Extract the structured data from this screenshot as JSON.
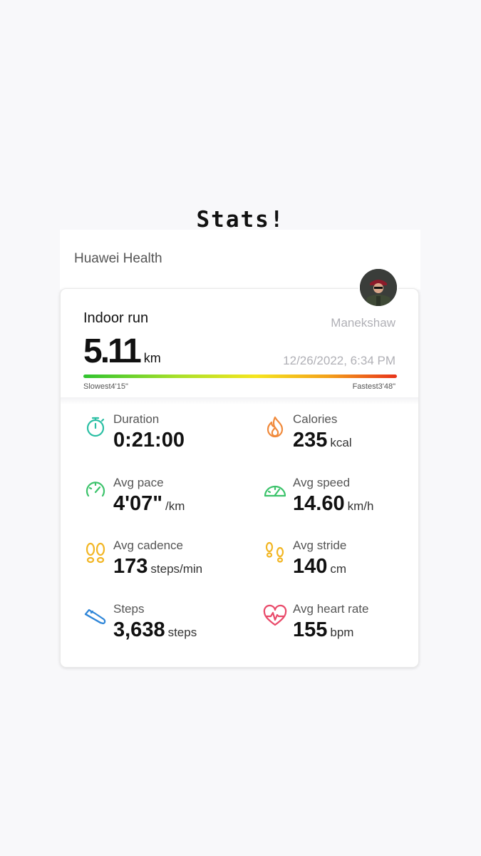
{
  "story_title": "Stats!",
  "app": {
    "name": "Huawei Health"
  },
  "workout": {
    "type": "Indoor run",
    "user": "Manekshaw",
    "distance_value": "5.11",
    "distance_unit": "km",
    "datetime": "12/26/2022, 6:34 PM",
    "slowest_label": "Slowest4'15\"",
    "fastest_label": "Fastest3'48\""
  },
  "metrics": [
    {
      "label": "Duration",
      "value": "0:21:00",
      "unit": "",
      "icon": "stopwatch-icon",
      "color": "#2bbfa4"
    },
    {
      "label": "Calories",
      "value": "235",
      "unit": "kcal",
      "icon": "flame-icon",
      "color": "#f08a3c"
    },
    {
      "label": "Avg pace",
      "value": "4'07\"",
      "unit": "/km",
      "icon": "pace-gauge-icon",
      "color": "#3cc36b"
    },
    {
      "label": "Avg speed",
      "value": "14.60",
      "unit": "km/h",
      "icon": "speedometer-icon",
      "color": "#3cc36b"
    },
    {
      "label": "Avg cadence",
      "value": "173",
      "unit": "steps/min",
      "icon": "footprints-icon",
      "color": "#f2b624"
    },
    {
      "label": "Avg stride",
      "value": "140",
      "unit": "cm",
      "icon": "stride-icon",
      "color": "#f2b624"
    },
    {
      "label": "Steps",
      "value": "3,638",
      "unit": "steps",
      "icon": "shoe-icon",
      "color": "#2f86d8"
    },
    {
      "label": "Avg heart rate",
      "value": "155",
      "unit": "bpm",
      "icon": "heart-rate-icon",
      "color": "#e94a6a"
    }
  ]
}
